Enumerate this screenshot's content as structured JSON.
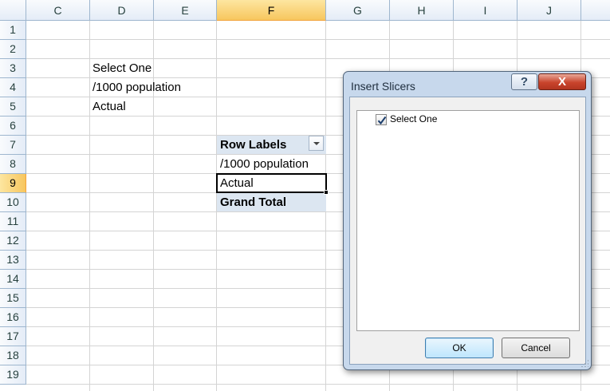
{
  "columns": [
    "C",
    "D",
    "E",
    "F",
    "G",
    "H",
    "I",
    "J"
  ],
  "active_column": "F",
  "rows": [
    "1",
    "2",
    "3",
    "4",
    "5",
    "6",
    "7",
    "8",
    "9",
    "10",
    "11",
    "12",
    "13",
    "14",
    "15",
    "16",
    "17",
    "18",
    "19"
  ],
  "active_row": "9",
  "cells": {
    "D3": "Select One",
    "D4": "/1000 population",
    "D5": "Actual"
  },
  "pivot": {
    "header": "Row Labels",
    "items": [
      "/1000 population",
      "Actual"
    ],
    "grand_total": "Grand Total"
  },
  "dialog": {
    "title": "Insert Slicers",
    "help_label": "?",
    "close_label": "X",
    "options": [
      {
        "label": "Select One",
        "checked": true
      }
    ],
    "ok_label": "OK",
    "cancel_label": "Cancel"
  }
}
